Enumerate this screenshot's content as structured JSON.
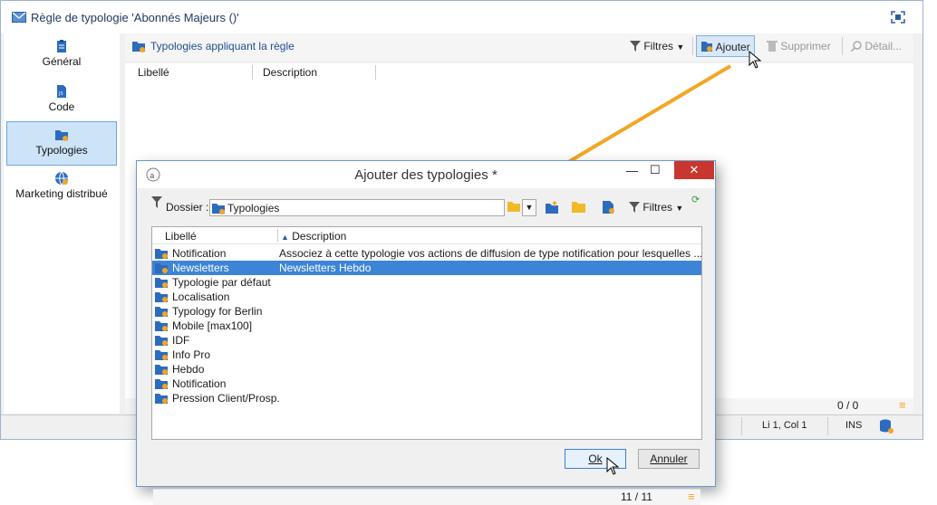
{
  "window": {
    "title": "Règle de typologie 'Abonnés Majeurs ()'"
  },
  "sidebar": {
    "items": [
      {
        "label": "Général",
        "icon": "clipboard-icon"
      },
      {
        "label": "Code",
        "icon": "code-file-icon"
      },
      {
        "label": "Typologies",
        "icon": "typology-folder-icon",
        "active": true
      },
      {
        "label": "Marketing distribué",
        "icon": "globe-icon"
      }
    ]
  },
  "toolbar": {
    "section_title": "Typologies appliquant la règle",
    "filters_label": "Filtres",
    "add_label": "Ajouter",
    "delete_label": "Supprimer",
    "detail_label": "Détail..."
  },
  "grid": {
    "columns": [
      "Libellé",
      "Description"
    ],
    "count": "0 / 0"
  },
  "status": {
    "position": "Li 1, Col 1",
    "mode": "INS"
  },
  "dialog": {
    "title": "Ajouter des typologies *",
    "folder_label": "Dossier :",
    "folder_value": "Typologies",
    "filters_label": "Filtres",
    "columns": [
      "Libellé",
      "Description"
    ],
    "rows": [
      {
        "label": "Notification",
        "description": "Associez à cette typologie vos actions de diffusion de type notification pour lesquelles ..."
      },
      {
        "label": "Newsletters",
        "description": "Newsletters Hebdo",
        "selected": true
      },
      {
        "label": "Typologie par défaut",
        "description": ""
      },
      {
        "label": "Localisation",
        "description": ""
      },
      {
        "label": "Typology for Berlin",
        "description": ""
      },
      {
        "label": "Mobile [max100]",
        "description": ""
      },
      {
        "label": "IDF",
        "description": ""
      },
      {
        "label": "Info Pro",
        "description": ""
      },
      {
        "label": "Hebdo",
        "description": ""
      },
      {
        "label": "Notification",
        "description": ""
      },
      {
        "label": "Pression Client/Prosp.",
        "description": ""
      }
    ],
    "count": "11 / 11",
    "ok_label": "Ok",
    "cancel_label": "Annuler"
  },
  "colors": {
    "accent": "#3d84d6",
    "arrow": "#f2a623",
    "close": "#c7372f"
  }
}
